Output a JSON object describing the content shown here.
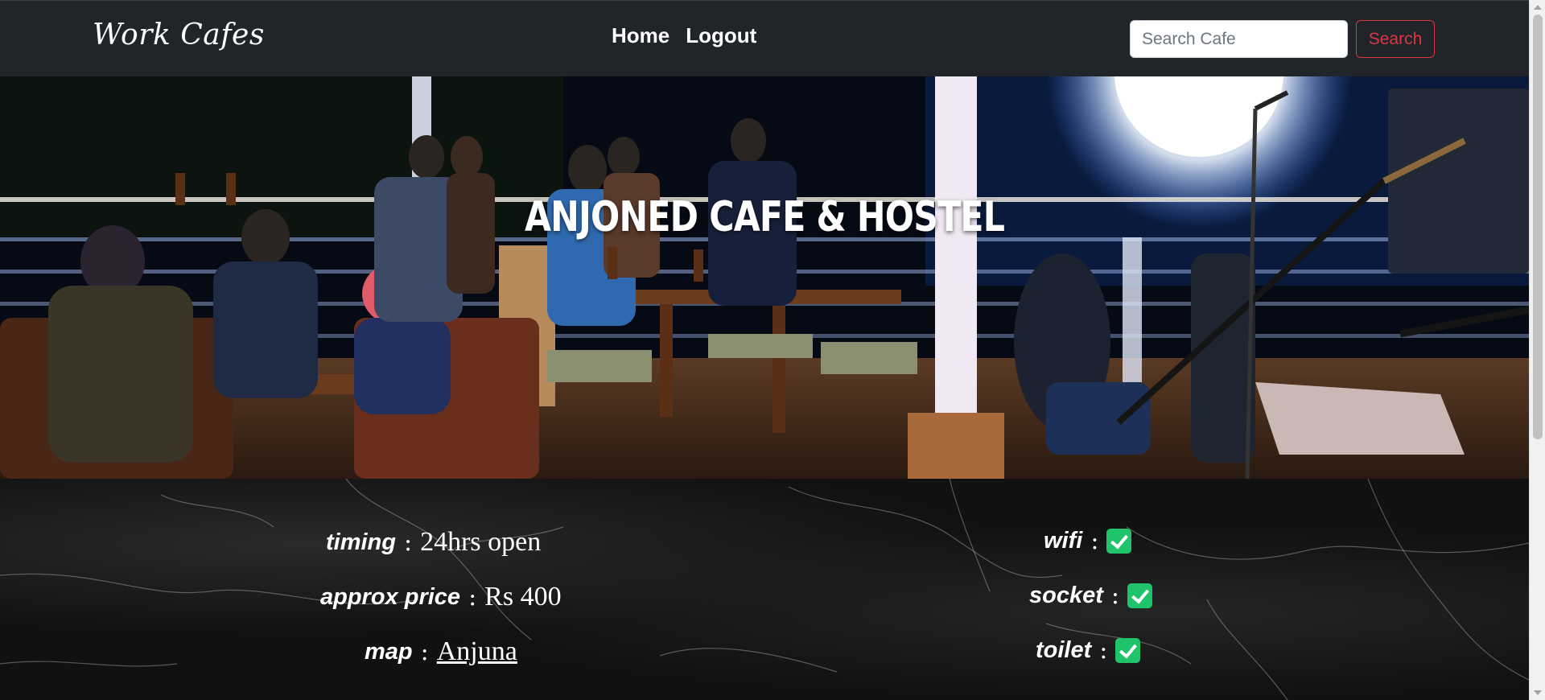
{
  "navbar": {
    "brand": "Work Cafes",
    "links": [
      {
        "label": "Home"
      },
      {
        "label": "Logout"
      }
    ],
    "search": {
      "placeholder": "Search Cafe",
      "value": "",
      "button_label": "Search"
    }
  },
  "hero": {
    "title": "ANJONED CAFE & HOSTEL"
  },
  "details": {
    "left": [
      {
        "label": "timing",
        "value": "24hrs open"
      },
      {
        "label": "approx price",
        "value": "Rs 400"
      },
      {
        "label": "map",
        "value": "Anjuna"
      }
    ],
    "right": [
      {
        "label": "wifi",
        "icon": "checkbox-checked-icon"
      },
      {
        "label": "socket",
        "icon": "checkbox-checked-icon"
      },
      {
        "label": "toilet",
        "icon": "checkbox-checked-icon"
      }
    ]
  },
  "colors": {
    "navbar_bg": "#212529",
    "search_button": "#dc3545",
    "check_green": "#1fc36a"
  }
}
